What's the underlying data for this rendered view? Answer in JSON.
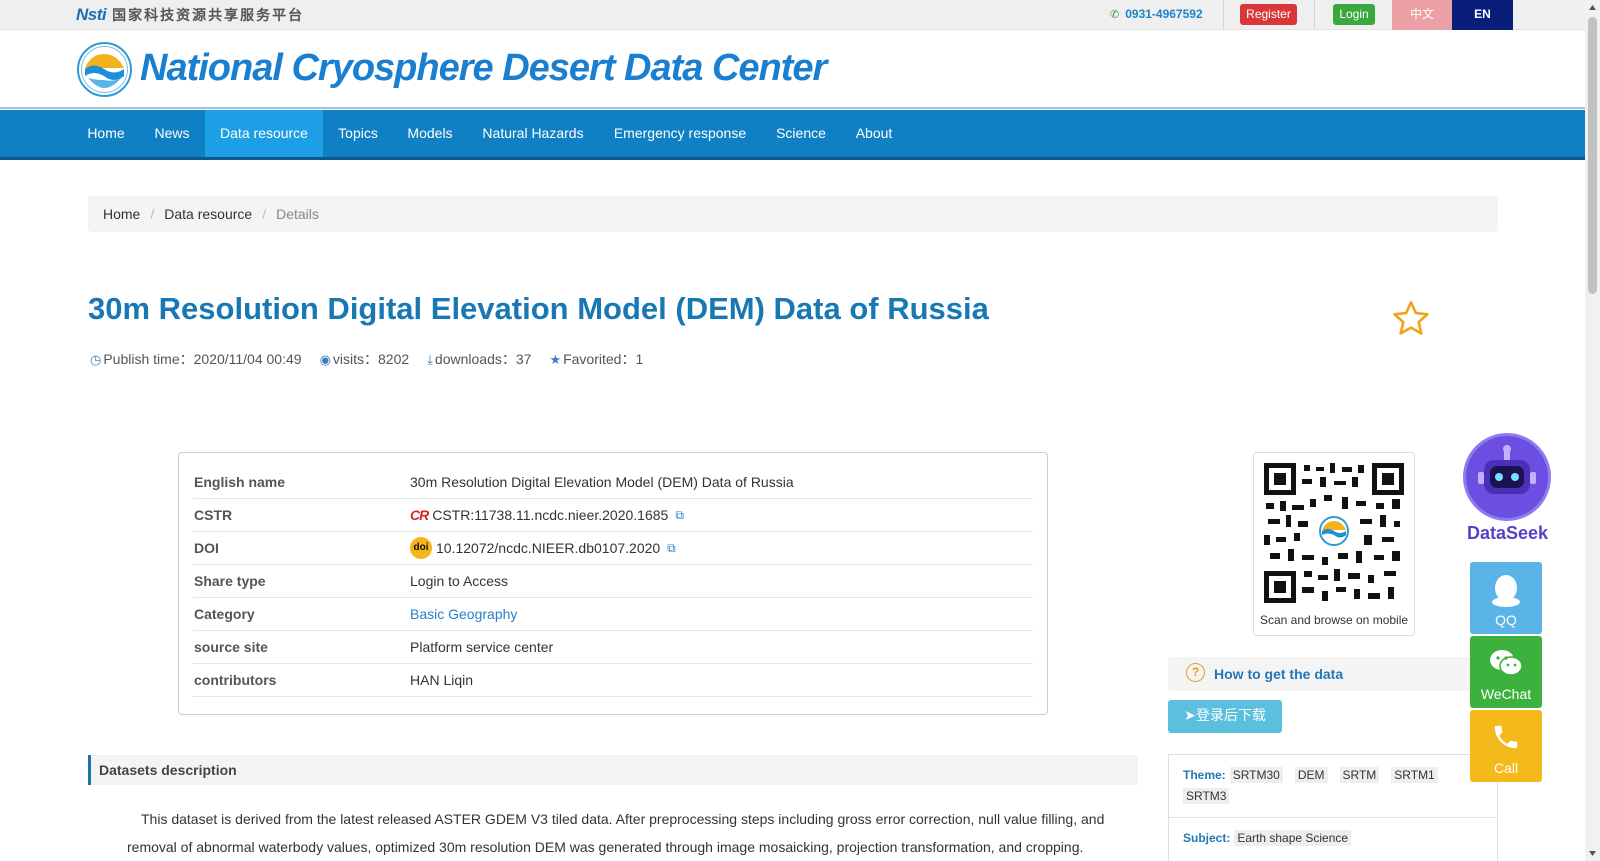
{
  "topbar": {
    "nsti_mark": "Nsti",
    "nsti_text": "国家科技资源共享服务平台",
    "phone": "0931-4967592",
    "register_label": "Register",
    "login_label": "Login",
    "lang_zh": "中文",
    "lang_en": "EN"
  },
  "header": {
    "site_title": "National Cryosphere Desert Data Center"
  },
  "nav": {
    "items": [
      "Home",
      "News",
      "Data resource",
      "Topics",
      "Models",
      "Natural Hazards",
      "Emergency response",
      "Science",
      "About"
    ],
    "active": "Data resource"
  },
  "breadcrumb": {
    "home": "Home",
    "section": "Data resource",
    "current": "Details"
  },
  "dataset": {
    "title": "30m Resolution Digital Elevation Model (DEM) Data of Russia",
    "publish_time": "Publish time：2020/11/04 00:49",
    "visits": "visits：8202",
    "downloads": "downloads：37",
    "favorited": "Favorited：1"
  },
  "info": {
    "english_name_label": "English name",
    "english_name": "30m Resolution Digital Elevation Model (DEM) Data of Russia",
    "cstr_label": "CSTR",
    "cstr": "CSTR:11738.11.ncdc.nieer.2020.1685",
    "doi_label": "DOI",
    "doi_badge": "doi",
    "doi": "10.12072/ncdc.NIEER.db0107.2020",
    "share_type_label": "Share type",
    "share_type": "Login to Access",
    "category_label": "Category",
    "category": "Basic Geography",
    "source_site_label": "source site",
    "source_site": "Platform service center",
    "contributors_label": "contributors",
    "contributors": "HAN Liqin"
  },
  "description": {
    "heading": "Datasets description",
    "text": "This dataset is derived from the latest released ASTER GDEM V3 tiled data. After preprocessing steps including gross error correction, null value filling, and removal of abnormal waterbody values, optimized 30m resolution DEM was generated through image mosaicking, projection transformation, and cropping."
  },
  "sidebar": {
    "qr_caption": "Scan and browse on mobile",
    "howto_label": "How to get the data",
    "download_label": "登录后下载",
    "theme_label": "Theme:",
    "themes": [
      "SRTM30",
      "DEM",
      "SRTM",
      "SRTM1",
      "SRTM3"
    ],
    "subject_label": "Subject:",
    "subject": "Earth shape Science"
  },
  "float": {
    "dataseek": "DataSeek",
    "qq": "QQ",
    "wechat": "WeChat",
    "call": "Call"
  },
  "colors": {
    "nav_bg": "#0f80c3",
    "nav_active": "#1d9fe6",
    "title": "#1878b3",
    "register": "#d9383a",
    "login": "#3aa73f"
  }
}
